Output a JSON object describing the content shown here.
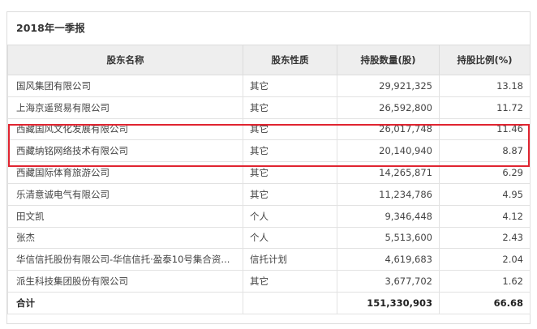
{
  "period_title": "2018年一季报",
  "columns": [
    "股东名称",
    "股东性质",
    "持股数量(股)",
    "持股比例(%)"
  ],
  "rows": [
    {
      "name": "国风集团有限公司",
      "nature": "其它",
      "shares": "29,921,325",
      "ratio": "13.18"
    },
    {
      "name": "上海京遥贸易有限公司",
      "nature": "其它",
      "shares": "26,592,800",
      "ratio": "11.72"
    },
    {
      "name": "西藏国风文化发展有限公司",
      "nature": "其它",
      "shares": "26,017,748",
      "ratio": "11.46"
    },
    {
      "name": "西藏纳铭网络技术有限公司",
      "nature": "其它",
      "shares": "20,140,940",
      "ratio": "8.87"
    },
    {
      "name": "西藏国际体育旅游公司",
      "nature": "其它",
      "shares": "14,265,871",
      "ratio": "6.29"
    },
    {
      "name": "乐清意诚电气有限公司",
      "nature": "其它",
      "shares": "11,234,786",
      "ratio": "4.95"
    },
    {
      "name": "田文凯",
      "nature": "个人",
      "shares": "9,346,448",
      "ratio": "4.12"
    },
    {
      "name": "张杰",
      "nature": "个人",
      "shares": "5,513,600",
      "ratio": "2.43"
    },
    {
      "name": "华信信托股份有限公司-华信信托·盈泰10号集合资...",
      "nature": "信托计划",
      "shares": "4,619,683",
      "ratio": "2.04"
    },
    {
      "name": "派生科技集团股份有限公司",
      "nature": "其它",
      "shares": "3,677,702",
      "ratio": "1.62"
    }
  ],
  "total": {
    "label": "合计",
    "nature": "",
    "shares": "151,330,903",
    "ratio": "66.68"
  },
  "colors": {
    "highlight_border": "#e02430",
    "header_bg": "#eeeeee",
    "grid": "#dcdcdc"
  }
}
